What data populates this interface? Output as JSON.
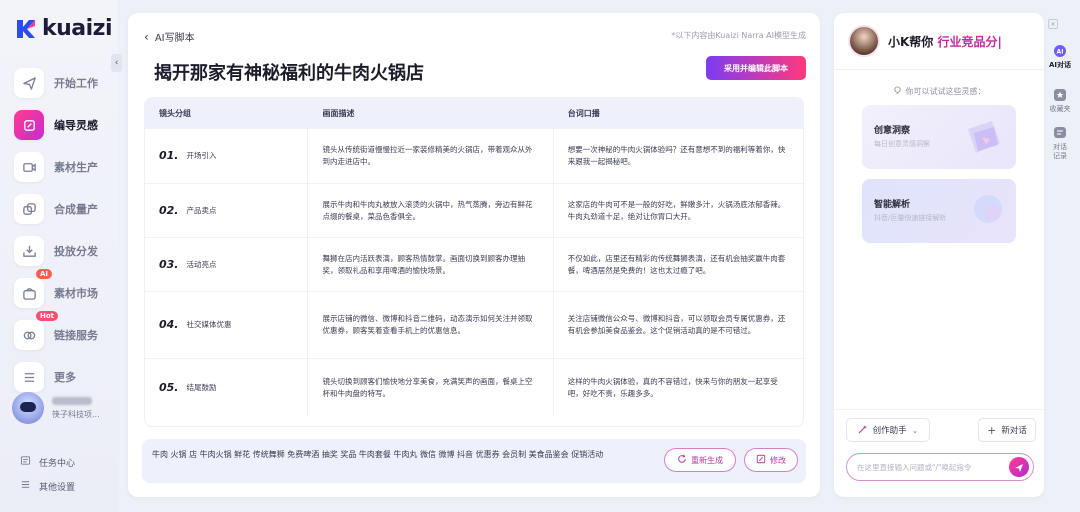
{
  "app": {
    "logo_text": "kuaizi"
  },
  "sidebar": {
    "items": [
      {
        "label": "开始工作",
        "icon": "send-icon"
      },
      {
        "label": "编导灵感",
        "icon": "pen-icon",
        "active": true
      },
      {
        "label": "素材生产",
        "icon": "video-icon"
      },
      {
        "label": "合成量产",
        "icon": "layers-icon"
      },
      {
        "label": "投放分发",
        "icon": "inbox-icon"
      },
      {
        "label": "素材市场",
        "icon": "bag-icon",
        "badge": "AI"
      },
      {
        "label": "链接服务",
        "icon": "link-icon",
        "badge": "Hot"
      },
      {
        "label": "更多",
        "icon": "menu-icon"
      }
    ],
    "user": {
      "sub": "筷子科技项..."
    },
    "links": [
      {
        "label": "任务中心",
        "icon": "task-icon"
      },
      {
        "label": "其他设置",
        "icon": "settings-icon"
      }
    ]
  },
  "main": {
    "back_label": "AI写脚本",
    "source_note": "*以下内容由Kuaizi Narra AI模型生成",
    "title": "揭开那家有神秘福利的牛肉火锅店",
    "adopt_button": "采用并编辑此脚本",
    "table": {
      "headers": [
        "镜头分组",
        "画面描述",
        "台词口播"
      ],
      "rows": [
        {
          "num": "01.",
          "segment": "开场引入",
          "desc": "镜头从传统街道慢慢拉近一家装修精美的火锅店，带着观众从外到内走进店中。",
          "line": "想要一次神秘的牛肉火锅体验吗？还有意想不到的福利等着你，快来跟我一起揭秘吧。"
        },
        {
          "num": "02.",
          "segment": "产品卖点",
          "desc": "展示牛肉和牛肉丸被放入滚烫的火锅中，热气蒸腾，旁边有鲜花点缀的餐桌，菜品色香俱全。",
          "line": "这家店的牛肉可不是一般的好吃，鲜嫩多汁，火锅汤底浓郁香辣。牛肉丸劲道十足，绝对让你胃口大开。"
        },
        {
          "num": "03.",
          "segment": "活动亮点",
          "desc": "舞狮在店内活跃表演，顾客热情鼓掌。画面切换到顾客办理抽奖，领取礼品和享用啤酒的愉快场景。",
          "line": "不仅如此，店里还有精彩的传统舞狮表演，还有机会抽奖赢牛肉套餐，啤酒居然是免费的！这也太过瘾了吧。"
        },
        {
          "num": "04.",
          "segment": "社交媒体优惠",
          "desc": "展示店铺的微信、微博和抖音二维码，动态演示如何关注并领取优惠券，顾客笑着查看手机上的优惠信息。",
          "line": "关注店铺微信公众号、微博和抖音，可以领取会员专属优惠券，还有机会参加美食品鉴会。这个促销活动真的是不可错过。"
        },
        {
          "num": "05.",
          "segment": "结尾鼓励",
          "desc": "镜头切换到顾客们愉快地分享美食，充满笑声的画面，餐桌上空杯和牛肉盘的特写。",
          "line": "这样的牛肉火锅体验，真的不容错过，快来与你的朋友一起享受吧，好吃不贵，乐趣多多。"
        }
      ]
    },
    "keywords": "牛肉 火锅 店 牛肉火锅 鲜花 传统舞狮 免费啤酒 抽奖 奖品 牛肉套餐 牛肉丸 微信 微博 抖音 优惠券 会员制 美食品鉴会 促销活动",
    "regenerate_button": "重新生成",
    "edit_button": "修改"
  },
  "ai_panel": {
    "title_prefix": "小K帮你",
    "title_highlight": "行业竞品分",
    "hint": "你可以试试这些灵感：",
    "cards": [
      {
        "title": "创意洞察",
        "sub": "每日创意灵感洞察"
      },
      {
        "title": "智能解析",
        "sub": "抖音/巨量快速链接解析"
      }
    ],
    "assistant_button": "创作助手",
    "new_chat_button": "新对话",
    "input_placeholder": "在这里直接输入问题或\"/\"唤起指令"
  },
  "rail": {
    "items": [
      {
        "label": "AI对话",
        "active": true
      },
      {
        "label": "收藏夹"
      },
      {
        "label": "对话记录"
      }
    ]
  },
  "colors": {
    "accent_pink": "#ff3c8e",
    "accent_purple": "#7d3cf2",
    "highlight": "#c5289f"
  }
}
